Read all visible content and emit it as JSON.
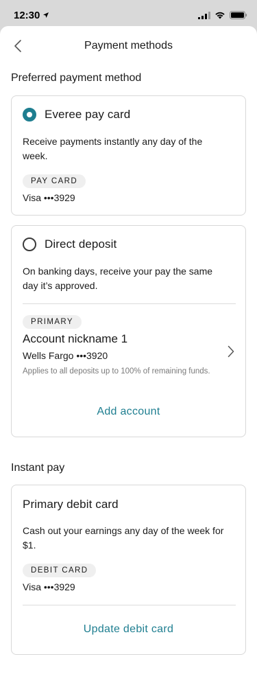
{
  "status_bar": {
    "time": "12:30"
  },
  "nav": {
    "title": "Payment methods"
  },
  "preferred": {
    "section_title": "Preferred payment method",
    "everee": {
      "title": "Everee pay card",
      "description": "Receive payments instantly any day of the week.",
      "pill": "PAY CARD",
      "card_number": "Visa •••3929",
      "selected": true
    },
    "direct_deposit": {
      "title": "Direct deposit",
      "description": "On banking days, receive your pay the same day it’s approved.",
      "selected": false,
      "account": {
        "pill": "PRIMARY",
        "nickname": "Account nickname 1",
        "bank": "Wells Fargo •••3920",
        "note": "Applies to all deposits up to 100% of remaining funds."
      },
      "add_account_label": "Add account"
    }
  },
  "instant_pay": {
    "section_title": "Instant pay",
    "card": {
      "title": "Primary debit card",
      "description": "Cash out your earnings any day of the week for $1.",
      "pill": "DEBIT CARD",
      "card_number": "Visa •••3929",
      "update_label": "Update debit card"
    }
  },
  "colors": {
    "accent": "#1e7e90",
    "border": "#d8d8d8",
    "pill_bg": "#efefef"
  }
}
